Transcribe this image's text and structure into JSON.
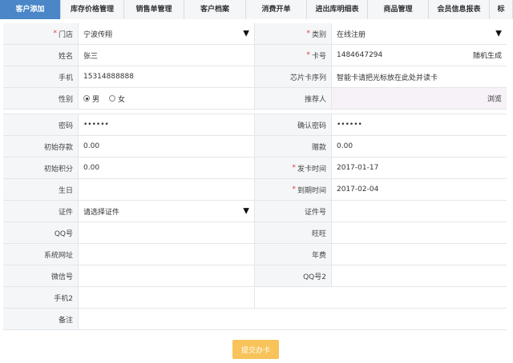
{
  "tabs": [
    "客户添加",
    "库存价格管理",
    "销售单管理",
    "客户档案",
    "消费开单",
    "进出库明细表",
    "商品管理",
    "会员信息报表",
    "标"
  ],
  "form": {
    "store_label": "门店",
    "store_value": "宁波传翔",
    "category_label": "类别",
    "category_value": "在线注册",
    "name_label": "姓名",
    "name_value": "张三",
    "card_label": "卡号",
    "card_value": "1484647294",
    "random_gen": "随机生成",
    "phone_label": "手机",
    "phone_value": "15314888888",
    "chip_label": "芯片卡序列",
    "chip_value": "智能卡请把光标放在此处并读卡",
    "gender_label": "性别",
    "gender_male": "男",
    "gender_female": "女",
    "referrer_label": "推荐人",
    "browse": "浏览",
    "password_label": "密码",
    "password_value": "••••••",
    "confirm_label": "确认密码",
    "confirm_value": "••••••",
    "deposit_label": "初始存款",
    "deposit_value": "0.00",
    "gift_label": "赠款",
    "gift_value": "0.00",
    "points_label": "初始积分",
    "points_value": "0.00",
    "issue_label": "发卡时间",
    "issue_value": "2017-01-17",
    "birthday_label": "生日",
    "expire_label": "到期时间",
    "expire_value": "2017-02-04",
    "cert_label": "证件",
    "cert_value": "请选择证件",
    "cert_no_label": "证件号",
    "qq_label": "QQ号",
    "wangwang_label": "旺旺",
    "website_label": "系统网址",
    "fee_label": "年费",
    "wechat_label": "微信号",
    "qq2_label": "QQ号2",
    "phone2_label": "手机2",
    "note_label": "备注",
    "required_mark": "*",
    "select_arrow": "▼"
  },
  "submit_label": "提交办卡",
  "colors": {
    "active_tab": "#4a86c8",
    "submit": "#f7c35a",
    "required": "#e03a3a"
  }
}
